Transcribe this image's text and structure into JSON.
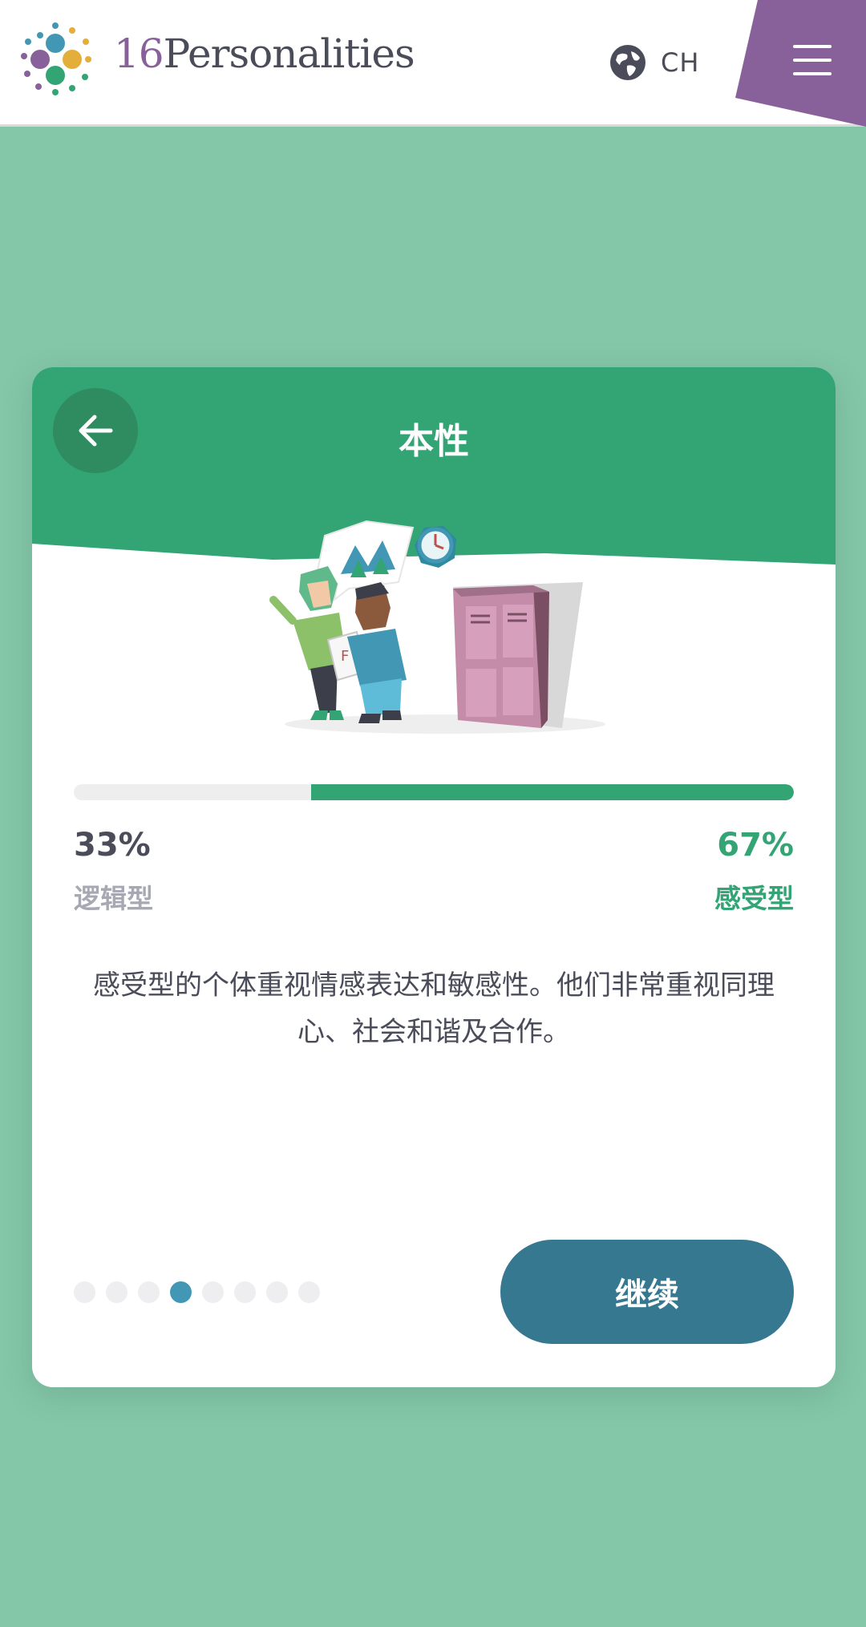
{
  "header": {
    "brand_number": "16",
    "brand_name": "Personalities",
    "language": "CH",
    "icons": [
      "logo-dots",
      "globe-icon",
      "hamburger-menu-icon"
    ],
    "menu_color": "#88619a"
  },
  "card": {
    "title": "本性",
    "back_icon": "arrow-left-icon",
    "accent_color": "#33a474",
    "progress": {
      "left_percent": "33%",
      "right_percent": "67%",
      "right_fraction": 0.67,
      "left_trait": "逻辑型",
      "right_trait": "感受型"
    },
    "description": "感受型的个体重视情感表达和敏感性。他们非常重视同理心、社会和谐及合作。",
    "pagination": {
      "total": 8,
      "current_index": 3
    },
    "continue_label": "继续",
    "continue_color": "#35788f"
  }
}
